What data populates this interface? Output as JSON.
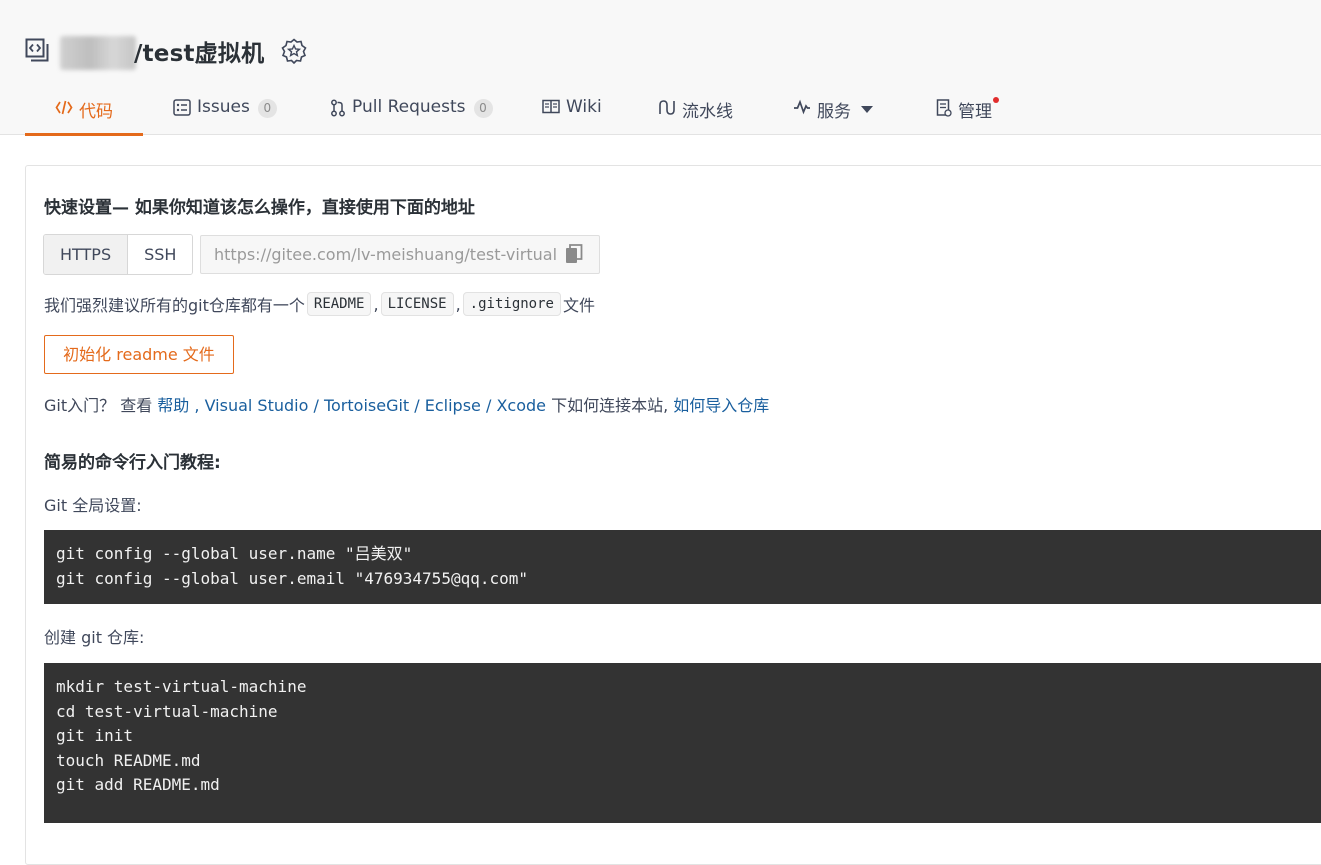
{
  "repo": {
    "title": "/test虚拟机"
  },
  "tabs": [
    {
      "label": "代码"
    },
    {
      "label": "Issues",
      "count": "0"
    },
    {
      "label": "Pull Requests",
      "count": "0"
    },
    {
      "label": "Wiki"
    },
    {
      "label": "流水线"
    },
    {
      "label": "服务"
    },
    {
      "label": "管理"
    }
  ],
  "quick_setup": {
    "title": "快速设置— 如果你知道该怎么操作，直接使用下面的地址",
    "protocols": [
      "HTTPS",
      "SSH"
    ],
    "url": "https://gitee.com/lv-meishuang/test-virtual",
    "recommend_prefix": "我们强烈建议所有的git仓库都有一个",
    "files": [
      "README",
      "LICENSE",
      ".gitignore"
    ],
    "sep": ",",
    "recommend_suffix": "文件",
    "init_button": "初始化 readme 文件",
    "intro_prefix": "Git入门？ 查看 ",
    "help": "帮助",
    "comma": " , ",
    "visual_studio": "Visual Studio",
    "slash": " / ",
    "tortoisegit": "TortoiseGit",
    "eclipse": "Eclipse",
    "xcode": "Xcode",
    "intro_mid": " 下如何连接本站, ",
    "import_link": "如何导入仓库"
  },
  "tutorial": {
    "title": "简易的命令行入门教程:",
    "global_label": "Git 全局设置:",
    "global_code": "git config --global user.name \"吕美双\"\ngit config --global user.email \"476934755@qq.com\"",
    "create_label": "创建 git 仓库:",
    "create_code": "mkdir test-virtual-machine\ncd test-virtual-machine\ngit init\ntouch README.md\ngit add README.md"
  },
  "colors": {
    "accent": "#e46a1b",
    "link": "#1a5f9e",
    "code_bg": "#333333"
  }
}
